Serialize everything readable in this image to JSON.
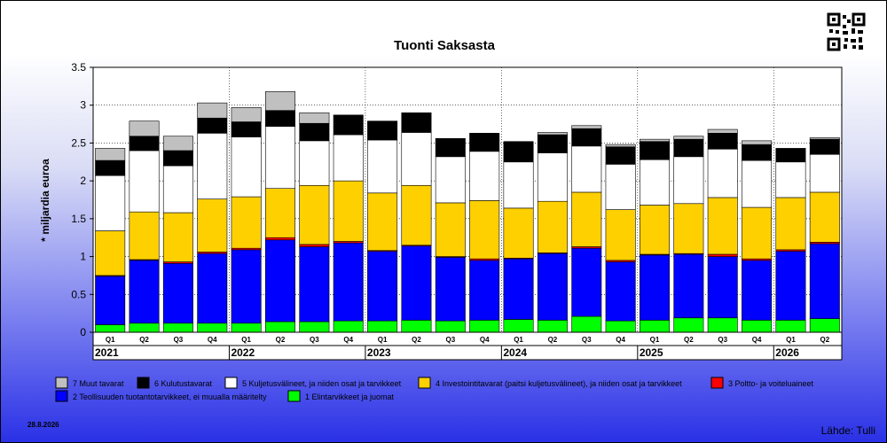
{
  "chart_data": {
    "type": "bar",
    "stacked": true,
    "title": "Tuonti Saksasta",
    "ylabel": "* miljardia euroa",
    "ylim": [
      0,
      3.5
    ],
    "yticks": [
      "0",
      "0.5",
      "1",
      "1.5",
      "2",
      "2.5",
      "3",
      "3.5"
    ],
    "quarter_labels": [
      "Q1",
      "Q2",
      "Q3",
      "Q4",
      "Q1",
      "Q2",
      "Q3",
      "Q4",
      "Q1",
      "Q2",
      "Q3",
      "Q4",
      "Q1",
      "Q2",
      "Q3",
      "Q4",
      "Q1",
      "Q2",
      "Q3",
      "Q4",
      "Q1",
      "Q2"
    ],
    "years": [
      {
        "label": "2021",
        "count": 4
      },
      {
        "label": "2022",
        "count": 4
      },
      {
        "label": "2023",
        "count": 4
      },
      {
        "label": "2024",
        "count": 4
      },
      {
        "label": "2025",
        "count": 4
      },
      {
        "label": "2026",
        "count": 2
      }
    ],
    "series": [
      {
        "name": "1 Elintarvikkeet ja juomat",
        "color": "#00ff00",
        "values": [
          0.1,
          0.12,
          0.12,
          0.12,
          0.12,
          0.14,
          0.14,
          0.15,
          0.15,
          0.16,
          0.15,
          0.16,
          0.17,
          0.16,
          0.21,
          0.15,
          0.16,
          0.19,
          0.19,
          0.16,
          0.16,
          0.18
        ]
      },
      {
        "name": "2 Teollisuuden tuotantotarvikkeet, ei muualla määritelty",
        "color": "#0000ff",
        "values": [
          0.64,
          0.83,
          0.79,
          0.92,
          0.97,
          1.08,
          0.99,
          1.03,
          0.92,
          0.98,
          0.84,
          0.79,
          0.8,
          0.88,
          0.9,
          0.78,
          0.86,
          0.84,
          0.81,
          0.79,
          0.91,
          0.99
        ]
      },
      {
        "name": "3 Poltto- ja voiteluaineet",
        "color": "#ff0000",
        "values": [
          0.01,
          0.01,
          0.02,
          0.02,
          0.02,
          0.03,
          0.03,
          0.02,
          0.01,
          0.01,
          0.01,
          0.02,
          0.01,
          0.01,
          0.02,
          0.02,
          0.01,
          0.01,
          0.03,
          0.02,
          0.02,
          0.02
        ]
      },
      {
        "name": "4 Investointitavarat (paitsi kuljetusvälineet), ja niiden osat ja tarvikkeet",
        "color": "#ffd000",
        "values": [
          0.59,
          0.63,
          0.65,
          0.7,
          0.68,
          0.65,
          0.78,
          0.8,
          0.76,
          0.79,
          0.71,
          0.77,
          0.66,
          0.68,
          0.72,
          0.67,
          0.65,
          0.66,
          0.75,
          0.68,
          0.69,
          0.66
        ]
      },
      {
        "name": "5 Kuljetusvälineet, ja niiden osat ja tarvikkeet",
        "color": "#ffffff",
        "values": [
          0.73,
          0.81,
          0.62,
          0.87,
          0.79,
          0.82,
          0.59,
          0.61,
          0.7,
          0.7,
          0.61,
          0.65,
          0.61,
          0.64,
          0.61,
          0.6,
          0.6,
          0.62,
          0.64,
          0.62,
          0.47,
          0.5
        ]
      },
      {
        "name": "6 Kulutustavarat",
        "color": "#000000",
        "values": [
          0.2,
          0.19,
          0.2,
          0.2,
          0.2,
          0.21,
          0.23,
          0.26,
          0.25,
          0.26,
          0.24,
          0.24,
          0.27,
          0.24,
          0.23,
          0.23,
          0.24,
          0.23,
          0.21,
          0.21,
          0.18,
          0.2
        ]
      },
      {
        "name": "7 Muut tavarat",
        "color": "#c0c0c0",
        "values": [
          0.16,
          0.2,
          0.19,
          0.2,
          0.19,
          0.25,
          0.14,
          0.0,
          0.0,
          0.0,
          0.0,
          0.0,
          0.0,
          0.03,
          0.04,
          0.03,
          0.03,
          0.04,
          0.05,
          0.05,
          0.0,
          0.02
        ]
      }
    ],
    "legend_placement": "bottom",
    "grid": true
  },
  "date": "28.8.2026",
  "source": "Lähde: Tulli"
}
